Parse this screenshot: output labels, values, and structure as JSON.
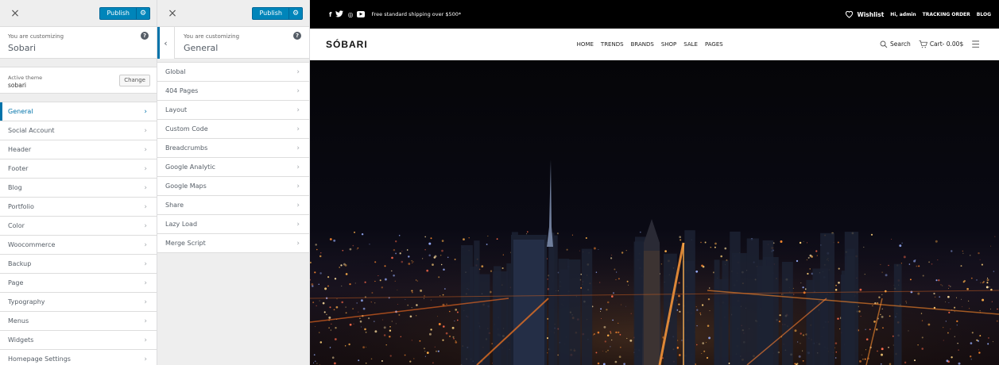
{
  "panel1": {
    "close": "×",
    "publish": "Publish",
    "gear": "⚙",
    "customizing_label": "You are customizing",
    "customizing_title": "Sobari",
    "help": "?",
    "active_theme_label": "Active theme",
    "active_theme_name": "sobari",
    "change": "Change",
    "items": [
      "General",
      "Social Account",
      "Header",
      "Footer",
      "Blog",
      "Portfolio",
      "Color",
      "Woocommerce",
      "Backup",
      "Page",
      "Typography",
      "Menus",
      "Widgets",
      "Homepage Settings"
    ],
    "active_item": "General"
  },
  "panel2": {
    "close": "×",
    "publish": "Publish",
    "gear": "⚙",
    "back": "‹",
    "customizing_label": "You are customizing",
    "customizing_title": "General",
    "help": "?",
    "items": [
      "Global",
      "404 Pages",
      "Layout",
      "Custom Code",
      "Breadcrumbs",
      "Google Analytic",
      "Google Maps",
      "Share",
      "Lazy Load",
      "Merge Script"
    ]
  },
  "site": {
    "social": {
      "facebook": "f",
      "twitter": "🐦",
      "instagram": "◎",
      "youtube": "▶"
    },
    "promo": "Free standard shipping over $500*",
    "wishlist": "Wishlist",
    "user": "Hi, admin",
    "tracking": "TRACKING ORDER",
    "blog": "BLOG",
    "logo": "SÓBARI",
    "nav": [
      "HOME",
      "TRENDS",
      "BRANDS",
      "SHOP",
      "SALE",
      "PAGES"
    ],
    "search": "Search",
    "cart": "Cart- 0.00$"
  },
  "colors": {
    "accent": "#0085ba",
    "active": "#0073aa"
  }
}
